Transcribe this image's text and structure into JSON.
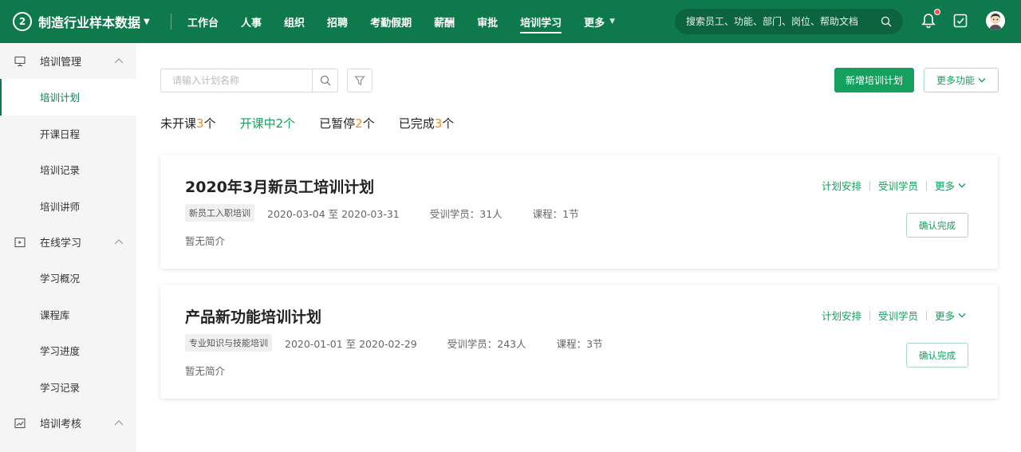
{
  "header": {
    "brand_name": "制造行业样本数据",
    "logo_text": "2",
    "nav": [
      {
        "label": "工作台"
      },
      {
        "label": "人事"
      },
      {
        "label": "组织"
      },
      {
        "label": "招聘"
      },
      {
        "label": "考勤假期"
      },
      {
        "label": "薪酬"
      },
      {
        "label": "审批"
      },
      {
        "label": "培训学习",
        "active": true
      },
      {
        "label": "更多"
      }
    ],
    "search_placeholder": "搜索员工、功能、部门、岗位、帮助文档"
  },
  "sidebar": {
    "groups": [
      {
        "label": "培训管理",
        "icon": "monitor-icon",
        "items": [
          {
            "label": "培训计划",
            "active": true
          },
          {
            "label": "开课日程"
          },
          {
            "label": "培训记录"
          },
          {
            "label": "培训讲师"
          }
        ]
      },
      {
        "label": "在线学习",
        "icon": "play-icon",
        "items": [
          {
            "label": "学习概况"
          },
          {
            "label": "课程库"
          },
          {
            "label": "学习进度"
          },
          {
            "label": "学习记录"
          }
        ]
      },
      {
        "label": "培训考核",
        "icon": "chart-icon",
        "items": []
      }
    ]
  },
  "main": {
    "search_placeholder": "请输入计划名称",
    "new_plan_label": "新增培训计划",
    "more_functions_label": "更多功能",
    "status_tabs": [
      {
        "label": "未开课",
        "count": "3",
        "unit": "个"
      },
      {
        "label": "开课中",
        "count": "2",
        "unit": "个",
        "active": true
      },
      {
        "label": "已暂停",
        "count": "2",
        "unit": "个"
      },
      {
        "label": "已完成",
        "count": "3",
        "unit": "个"
      }
    ],
    "plans": [
      {
        "title": "2020年3月新员工培训计划",
        "tag": "新员工入职培训",
        "date_range": "2020-03-04 至 2020-03-31",
        "trainees": "受训学员：31人",
        "courses": "课程：1节",
        "description": "暂无简介",
        "action_schedule": "计划安排",
        "action_trainees": "受训学员",
        "action_more": "更多",
        "confirm_label": "确认完成"
      },
      {
        "title": "产品新功能培训计划",
        "tag": "专业知识与技能培训",
        "date_range": "2020-01-01 至 2020-02-29",
        "trainees": "受训学员：243人",
        "courses": "课程：3节",
        "description": "暂无简介",
        "action_schedule": "计划安排",
        "action_trainees": "受训学员",
        "action_more": "更多",
        "confirm_label": "确认完成"
      }
    ]
  },
  "colors": {
    "header_bg": "#0e7a4c",
    "accent": "#15a05f",
    "count_orange": "#fa8c16",
    "notification_dot": "#ff4d4f"
  }
}
